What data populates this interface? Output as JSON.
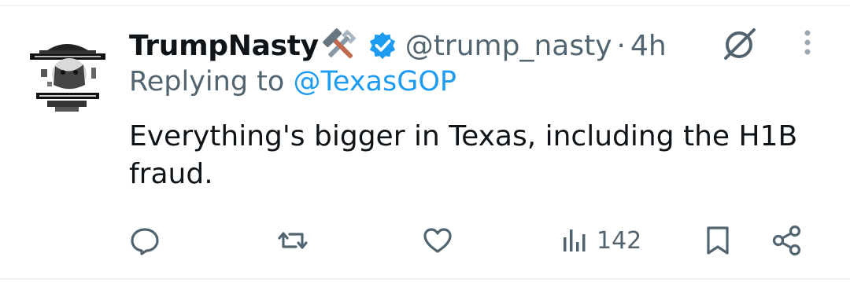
{
  "tweet": {
    "display_name": "TrumpNasty",
    "name_emoji": "hammer-and-wrench-emoji",
    "verified_badge": "verified-badge-icon",
    "handle": "@trump_nasty",
    "separator": "·",
    "time": "4h",
    "replying_prefix": "Replying to",
    "replying_to": "@TexasGOP",
    "text": "Everything's bigger in Texas, including the H1B fraud."
  },
  "actions": {
    "reply_icon": "reply-icon",
    "retweet_icon": "retweet-icon",
    "like_icon": "like-icon",
    "views_icon": "views-icon",
    "views_count": "142",
    "bookmark_icon": "bookmark-icon",
    "share_icon": "share-icon"
  },
  "header_icons": {
    "grok": "grok-icon",
    "more": "more-options-icon"
  },
  "colors": {
    "primary_text": "#0f1419",
    "secondary_text": "#536471",
    "accent": "#1d9bf0",
    "divider": "#eff3f4"
  }
}
